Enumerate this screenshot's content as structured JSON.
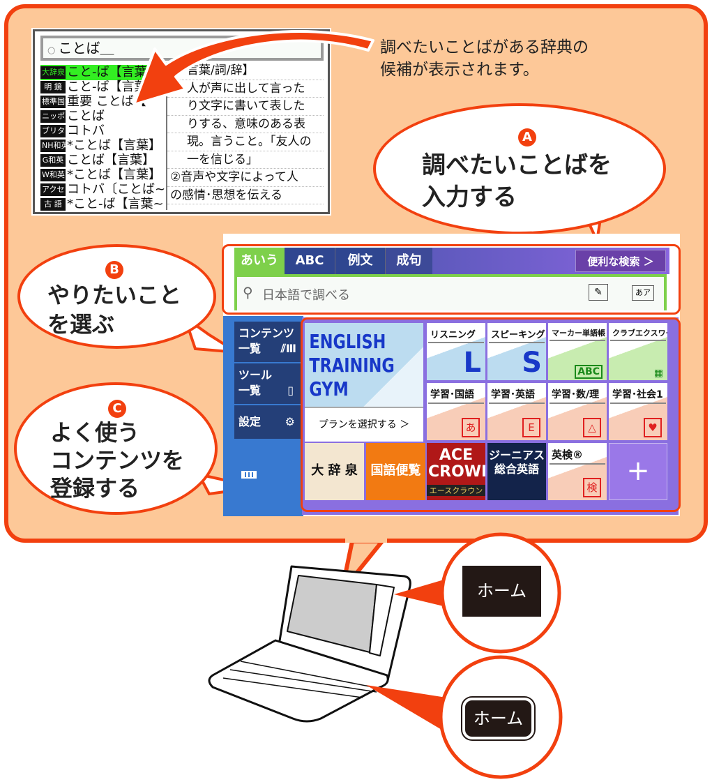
{
  "caption": [
    "調べたいことばがある辞典の",
    "候補が表示されます。"
  ],
  "dictionary_screen": {
    "search_value": "ことば＿",
    "candidates": [
      {
        "tag": "大辞泉",
        "text": "こと‐ば【言葉/",
        "selected": true
      },
      {
        "tag": "明 鏡",
        "text": "こと‐ば【言葉"
      },
      {
        "tag": "標準国語",
        "text": "重要 ことば【"
      },
      {
        "tag": "ニッポニカ",
        "text": "ことば"
      },
      {
        "tag": "ブリタニカ",
        "text": "コトバ"
      },
      {
        "tag": "NH和英",
        "text": "*ことば【言葉】"
      },
      {
        "tag": "G和英",
        "text": "ことば【言葉】"
      },
      {
        "tag": "W和英",
        "text": "*ことば【言葉】"
      },
      {
        "tag": "アクセント",
        "text": "コトバ〔ことば~"
      },
      {
        "tag": "古 語",
        "text": "*こと‐ば【言葉~"
      }
    ],
    "definition": [
      "言葉/詞/辞】",
      "人が声に出して言った",
      "り文字に書いて表した",
      "りする、意味のある表",
      "現。言うこと。「友人の",
      "一を信じる」",
      "②音声や文字によって人",
      "の感情･思想を伝える"
    ]
  },
  "callouts": {
    "a": {
      "badge": "A",
      "lines": [
        "調べたいことばを",
        "入力する"
      ]
    },
    "b": {
      "badge": "B",
      "lines": [
        "やりたいこと",
        "を選ぶ"
      ]
    },
    "c": {
      "badge": "C",
      "lines": [
        "よく使う",
        "コンテンツを",
        "登録する"
      ]
    }
  },
  "home_screen": {
    "tabs": [
      "あいう",
      "ABC",
      "例文",
      "成句"
    ],
    "active_tab": "あいう",
    "handy_search": "便利な検索 ＞",
    "search_placeholder": "日本語で調べる",
    "handwriting_icon": "pencil-icon",
    "kana_icon": "あア",
    "sidebar": [
      {
        "label": "コンテンツ\n一覧",
        "icon": "books-icon"
      },
      {
        "label": "ツール\n一覧",
        "icon": "tool-doc-icon"
      },
      {
        "label": "設定",
        "icon": "gear-icon"
      }
    ],
    "battery_icon": "battery-icon",
    "featured": {
      "title": [
        "ENGLISH",
        "TRAINING",
        "GYM"
      ],
      "action": "プランを選択する ＞"
    },
    "tiles_row1": [
      {
        "label": "リスニング",
        "glyph": "L"
      },
      {
        "label": "スピーキング",
        "glyph": "S"
      },
      {
        "label": "マーカー単語帳",
        "glyph": "ABC"
      },
      {
        "label": "クラブエクスワード",
        "glyph": "qr"
      }
    ],
    "tiles_row2": [
      {
        "label": "学習･国語",
        "glyph": "あ"
      },
      {
        "label": "学習･英語",
        "glyph": "E"
      },
      {
        "label": "学習･数/理",
        "glyph": "△"
      },
      {
        "label": "学習･社会1",
        "glyph": "♥"
      }
    ],
    "books": [
      {
        "title": "大 辞 泉"
      },
      {
        "title": "国語便覧"
      },
      {
        "title": "ACE CROWN",
        "sub": "エースクラウン"
      },
      {
        "title": "ジーニアス総合英語"
      },
      {
        "title": "英検®",
        "glyph": "検"
      }
    ],
    "add_label": "+"
  },
  "home_key_screen": "ホーム",
  "home_key_device": "ホーム",
  "colors": {
    "accent": "#f2400f",
    "panel": "#fdc898",
    "tab_active": "#7ed04b",
    "nav": "#243f78"
  }
}
